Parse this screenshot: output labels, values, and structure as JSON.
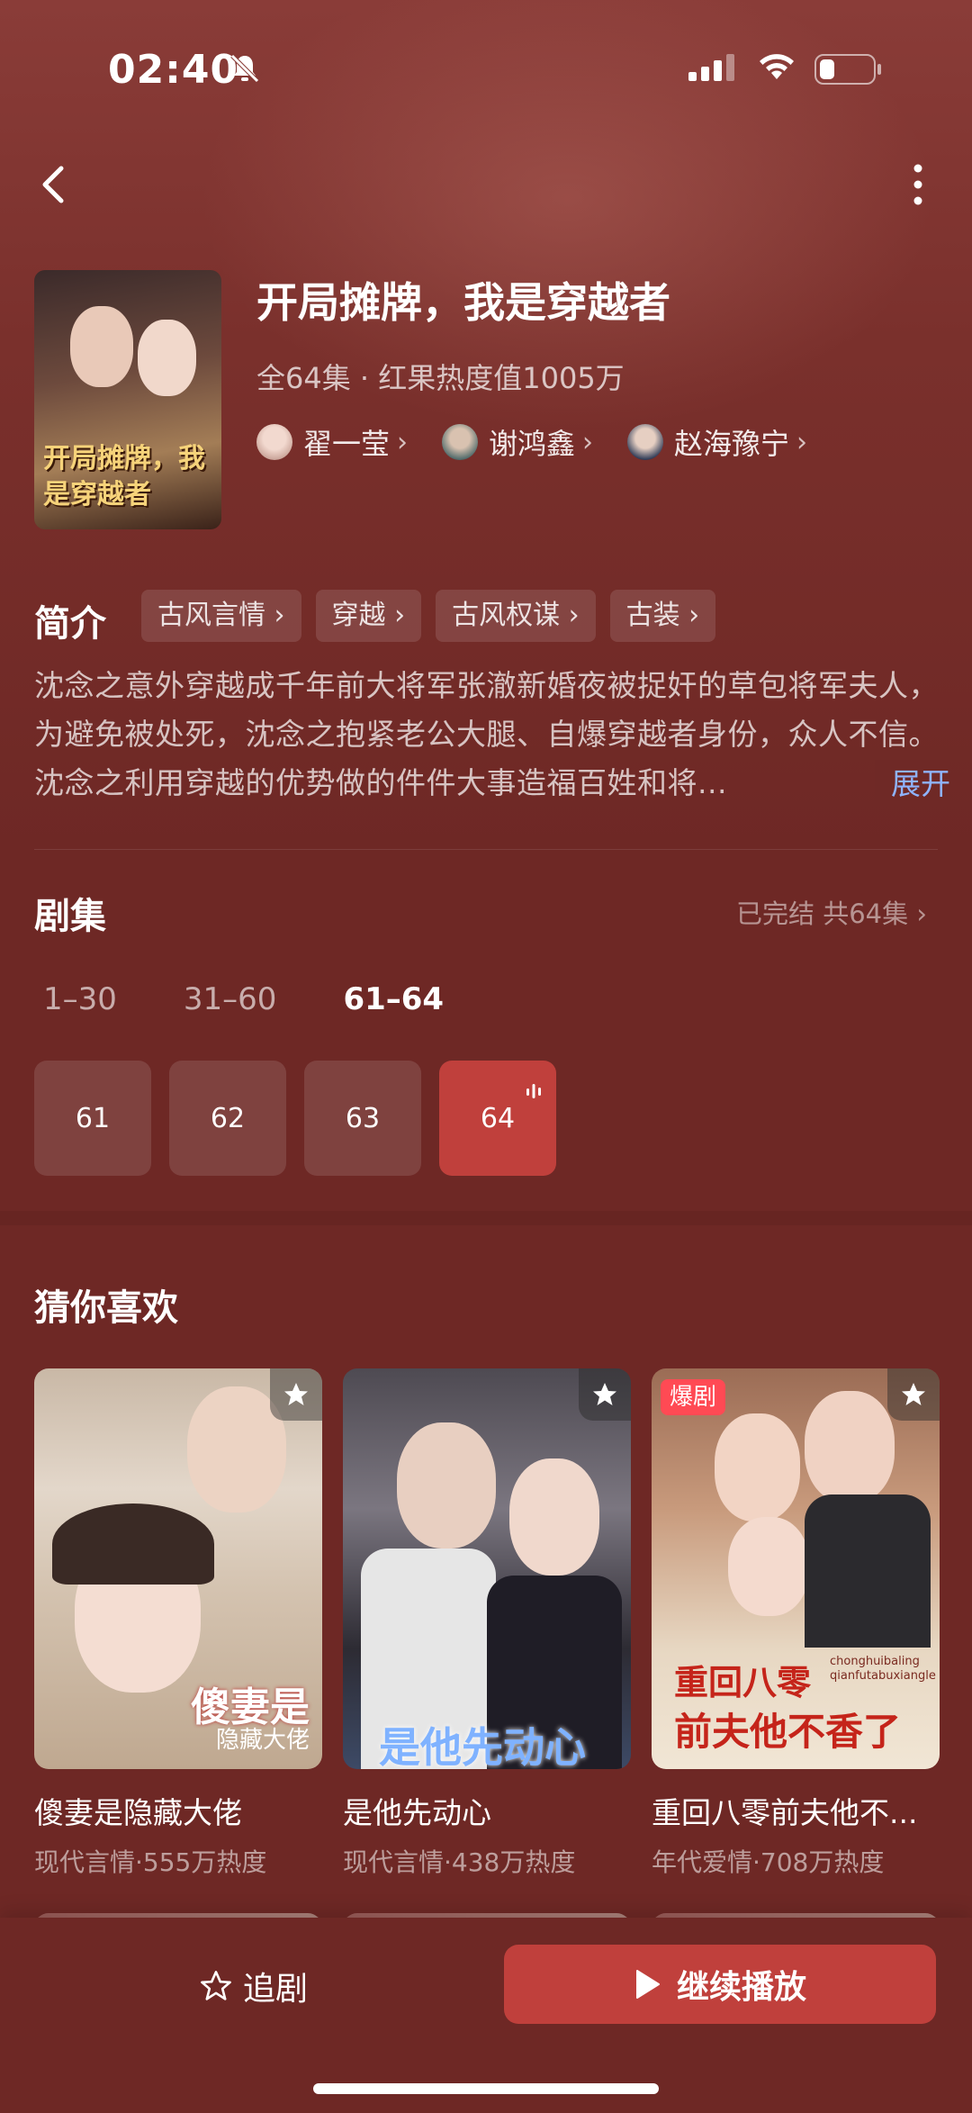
{
  "status_bar": {
    "time": "02:40"
  },
  "drama": {
    "title": "开局摊牌，我是穿越者",
    "meta": "全64集 · 红果热度值1005万",
    "poster_text": "开局摊牌，我是穿越者",
    "cast": [
      {
        "name": "翟一莹"
      },
      {
        "name": "谢鸿鑫"
      },
      {
        "name": "赵海豫宁"
      }
    ]
  },
  "intro": {
    "heading": "简介",
    "tags": [
      "古风言情",
      "穿越",
      "古风权谋",
      "古装"
    ],
    "synopsis": "沈念之意外穿越成千年前大将军张澈新婚夜被捉奸的草包将军夫人，为避免被处死，沈念之抱紧老公大腿、自爆穿越者身份，众人不信。沈念之利用穿越的优势做的件件大事造福百姓和将...",
    "expand_label": "展开"
  },
  "episodes": {
    "heading": "剧集",
    "status": "已完结 共64集",
    "ranges": [
      "1–30",
      "31–60",
      "61–64"
    ],
    "active_range": 2,
    "items": [
      "61",
      "62",
      "63",
      "64"
    ],
    "playing_index": 3
  },
  "recommend": {
    "heading": "猜你喜欢",
    "items": [
      {
        "title": "傻妻是隐藏大佬",
        "sub": "现代言情·555万热度",
        "thumb_text_1": "傻妻是",
        "thumb_text_2": "隐藏大佬"
      },
      {
        "title": "是他先动心",
        "sub": "现代言情·438万热度",
        "thumb_text_1": "是他先动心"
      },
      {
        "title": "重回八零前夫他不...",
        "sub": "年代爱情·708万热度",
        "badge": "爆剧",
        "thumb_text_1": "重回八零",
        "thumb_text_2": "前夫他不香了",
        "thumb_text_3": "chonghuibaling",
        "thumb_text_4": "qianfutabuxiangle"
      }
    ]
  },
  "bottom": {
    "follow_label": "追剧",
    "play_label": "继续播放"
  },
  "colors": {
    "background": "#6e2825",
    "accent": "#c0403c",
    "link": "#8fb4ff",
    "hot_badge": "#ff4a54"
  }
}
